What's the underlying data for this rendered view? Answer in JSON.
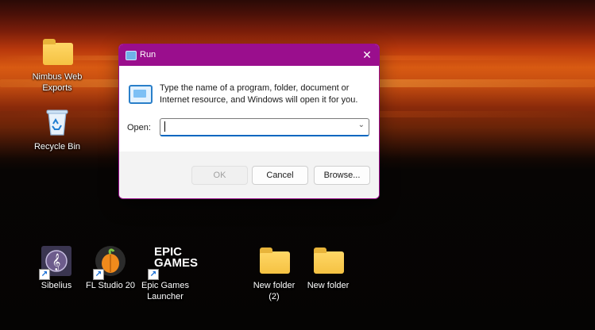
{
  "desktop": {
    "icons": [
      {
        "label": "Nimbus Web\nExports",
        "type": "folder"
      },
      {
        "label": "Recycle Bin",
        "type": "recycle-bin"
      },
      {
        "label": "Sibelius",
        "type": "app"
      },
      {
        "label": "FL Studio 20",
        "type": "app"
      },
      {
        "label": "Epic Games\nLauncher",
        "type": "app"
      },
      {
        "label": "New folder\n(2)",
        "type": "folder"
      },
      {
        "label": "New folder",
        "type": "folder"
      }
    ],
    "epic_logo_text": "EPIC\nGAMES"
  },
  "dialog": {
    "title": "Run",
    "close_glyph": "✕",
    "description": "Type the name of a program, folder, document or Internet resource, and Windows will open it for you.",
    "open_label": "Open:",
    "open_value": "",
    "ok_label": "OK",
    "cancel_label": "Cancel",
    "browse_label": "Browse...",
    "accent_color": "#9a0e8d"
  }
}
